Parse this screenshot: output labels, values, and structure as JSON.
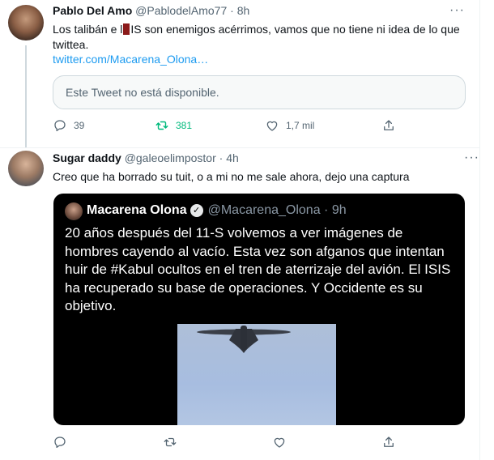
{
  "tweet1": {
    "name": "Pablo Del Amo",
    "handle": "@PablodelAmo77",
    "sep": "·",
    "time": "8h",
    "more": "···",
    "text_before": "Los talibán e l",
    "text_after": "IS son enemigos acérrimos, vamos que no tiene ni idea de lo que twittea.",
    "link": "twitter.com/Macarena_Olona…",
    "unavailable": "Este Tweet no está disponible.",
    "replies": "39",
    "retweets": "381",
    "likes": "1,7 mil",
    "colors": {
      "retweeted": "#00ba7c",
      "link": "#1d9bf0"
    }
  },
  "tweet2": {
    "name": "Sugar daddy",
    "handle": "@galeoelimpostor",
    "sep": "·",
    "time": "4h",
    "more": "···",
    "text": "Creo que ha borrado su tuit, o a mi no me sale ahora, dejo una captura",
    "embed": {
      "name": "Macarena Olona",
      "verified_icon": "check-badge-icon",
      "handle": "@Macarena_Olona",
      "sep": "·",
      "time": "9h",
      "text": "20 años después del 11-S volvemos a ver imágenes de hombres cayendo al vacío. Esta vez son afganos que intentan huir de #Kabul ocultos en el tren de aterrizaje del avión. El ISIS ha recuperado su base de operaciones.  Y Occidente es su objetivo."
    }
  },
  "icons": [
    "reply-icon",
    "retweet-icon",
    "like-icon",
    "share-icon"
  ]
}
